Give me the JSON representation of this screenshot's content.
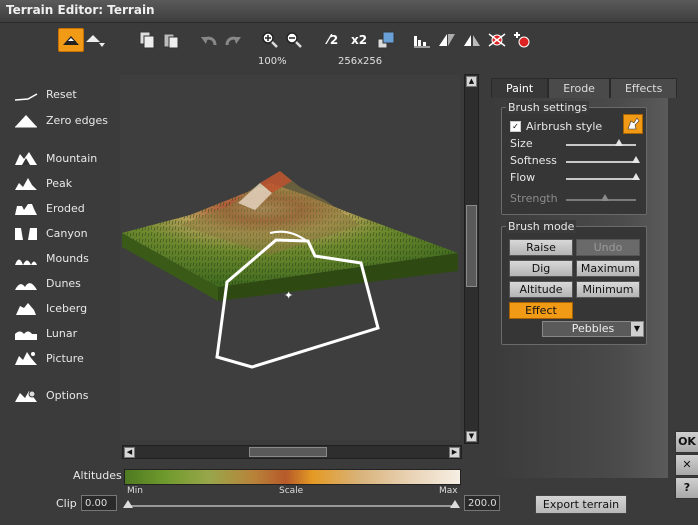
{
  "window": {
    "title": "Terrain Editor: Terrain"
  },
  "toolbar": {
    "zoom_label": "100%",
    "resolution_label": "256x256",
    "double_label": "x2",
    "half_label": "2"
  },
  "left_menu": {
    "items": [
      {
        "label": "Reset",
        "icon": "reset-icon"
      },
      {
        "label": "Zero edges",
        "icon": "zero-edges-icon"
      },
      {
        "label": "Mountain",
        "icon": "mountain-icon"
      },
      {
        "label": "Peak",
        "icon": "peak-icon"
      },
      {
        "label": "Eroded",
        "icon": "eroded-icon"
      },
      {
        "label": "Canyon",
        "icon": "canyon-icon"
      },
      {
        "label": "Mounds",
        "icon": "mounds-icon"
      },
      {
        "label": "Dunes",
        "icon": "dunes-icon"
      },
      {
        "label": "Iceberg",
        "icon": "iceberg-icon"
      },
      {
        "label": "Lunar",
        "icon": "lunar-icon"
      },
      {
        "label": "Picture",
        "icon": "picture-icon"
      },
      {
        "label": "Options",
        "icon": "options-icon"
      }
    ]
  },
  "altitudes": {
    "label": "Altitudes",
    "min": "Min",
    "scale": "Scale",
    "max": "Max"
  },
  "clip": {
    "label": "Clip",
    "min_value": "0.00",
    "max_value": "200.0"
  },
  "export_button": "Export terrain",
  "tabs": {
    "paint": "Paint",
    "erode": "Erode",
    "effects": "Effects",
    "selected": "Paint"
  },
  "brush_settings": {
    "title": "Brush settings",
    "airbrush_label": "Airbrush style",
    "airbrush_checked": true,
    "size_label": "Size",
    "softness_label": "Softness",
    "flow_label": "Flow",
    "strength_label": "Strength",
    "size_value": 0.75,
    "softness_value": 1.0,
    "flow_value": 1.0,
    "strength_value": 0.55
  },
  "brush_mode": {
    "title": "Brush mode",
    "raise": "Raise",
    "undo": "Undo",
    "dig": "Dig",
    "maximum": "Maximum",
    "altitude": "Altitude",
    "minimum": "Minimum",
    "effect": "Effect",
    "effect_selected": true,
    "effect_type": "Pebbles"
  },
  "side_buttons": {
    "ok": "OK",
    "close": "✕",
    "help": "?"
  },
  "colors": {
    "accent": "#f19a16"
  }
}
